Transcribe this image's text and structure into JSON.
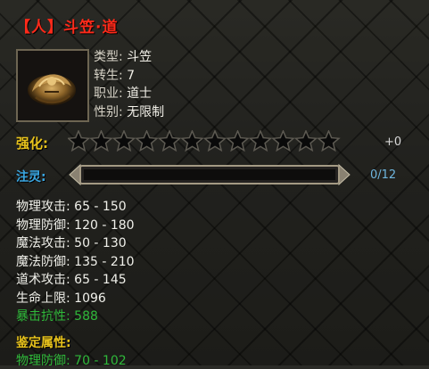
{
  "item": {
    "title": "【人】斗笠·道",
    "icon": "bamboo-hat-icon"
  },
  "info": {
    "rows": [
      {
        "key": "类型:",
        "value": "斗笠"
      },
      {
        "key": "转生:",
        "value": "7"
      },
      {
        "key": "职业:",
        "value": "道士"
      },
      {
        "key": "性别:",
        "value": "无限制"
      }
    ]
  },
  "enhance": {
    "label": "强化:",
    "filled": 0,
    "total": 12,
    "value": "+0"
  },
  "spirit": {
    "label": "注灵:",
    "progress": 0,
    "value": "0/12"
  },
  "stats": [
    {
      "text": "物理攻击: 65 - 150"
    },
    {
      "text": "物理防御: 120 - 180"
    },
    {
      "text": "魔法攻击: 50 - 130"
    },
    {
      "text": "魔法防御: 135 - 210"
    },
    {
      "text": "道术攻击: 65 - 145"
    },
    {
      "text": "生命上限: 1096"
    },
    {
      "text": "暴击抗性: 588"
    }
  ],
  "appraise": {
    "label": "鉴定属性:",
    "stat": "物理防御: 70 - 102"
  },
  "colors": {
    "title": "#ff2a1a",
    "gold": "#e8c31c",
    "spirit": "#3aa6e0",
    "bonus": "#2fb83a"
  }
}
